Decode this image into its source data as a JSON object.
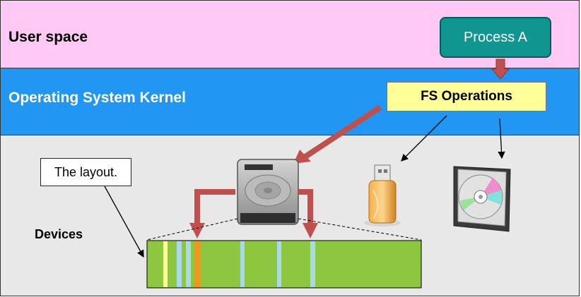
{
  "layers": {
    "user_space": "User space",
    "kernel": "Operating System Kernel",
    "devices": "Devices"
  },
  "boxes": {
    "process": "Process A",
    "fs_operations": "FS Operations",
    "layout_note": "The layout."
  },
  "devices": [
    "hard-disk",
    "usb-flash-drive",
    "optical-disc"
  ],
  "colors": {
    "user_space_bg": "#ffc8f5",
    "kernel_bg": "#2196f3",
    "devices_bg": "#e8e8e8",
    "process_bg": "#0f9690",
    "fs_box_bg": "#ffff99",
    "arrow_red": "#c0504d",
    "disk_green": "#8dc63f",
    "block_light_blue": "#a8d8ea",
    "block_yellow": "#ffff99",
    "block_orange": "#f7941d"
  }
}
